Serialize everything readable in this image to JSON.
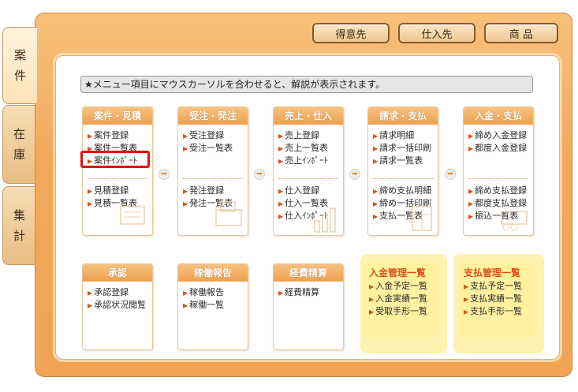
{
  "side_tabs": [
    {
      "label1": "案",
      "label2": "件"
    },
    {
      "label1": "在",
      "label2": "庫"
    },
    {
      "label1": "集",
      "label2": "計"
    }
  ],
  "top_buttons": [
    "得意先",
    "仕入先",
    "商 品"
  ],
  "hint": "★メニュー項目にマウスカーソルを合わせると、解説が表示されます。",
  "cards": [
    {
      "title": "案件・見積",
      "top": [
        "案件登録",
        "案件一覧表",
        "案件ｲﾝﾎﾟｰﾄ"
      ],
      "bottom": [
        "見積登録",
        "見積一覧表"
      ]
    },
    {
      "title": "受注・発注",
      "top": [
        "受注登録",
        "受注一覧表"
      ],
      "bottom": [
        "発注登録",
        "発注一覧表"
      ]
    },
    {
      "title": "売上・仕入",
      "top": [
        "売上登録",
        "売上一覧表",
        "売上ｲﾝﾎﾟｰﾄ"
      ],
      "bottom": [
        "仕入登録",
        "仕入一覧表",
        "仕入ｲﾝﾎﾟｰﾄ"
      ]
    },
    {
      "title": "請求・支払",
      "top": [
        "請求明細",
        "請求一括印刷",
        "請求一覧表"
      ],
      "bottom": [
        "締め支払明細",
        "締め一括印刷",
        "支払一覧表"
      ]
    },
    {
      "title": "入金・支払",
      "top": [
        "締め入金登録",
        "都度入金登録"
      ],
      "bottom": [
        "締め支払登録",
        "都度支払登録",
        "振込一覧表"
      ]
    }
  ],
  "lower_cards": [
    {
      "title": "承認",
      "items": [
        "承認登録",
        "承認状況閲覧"
      ]
    },
    {
      "title": "稼働報告",
      "items": [
        "稼働報告",
        "稼働一覧"
      ]
    },
    {
      "title": "経費精算",
      "items": [
        "経費精算"
      ]
    }
  ],
  "panels": [
    {
      "title": "入金管理一覧",
      "items": [
        "入金予定一覧",
        "入金実績一覧",
        "受取手形一覧"
      ]
    },
    {
      "title": "支払管理一覧",
      "items": [
        "支払予定一覧",
        "支払実績一覧",
        "支払手形一覧"
      ]
    }
  ]
}
